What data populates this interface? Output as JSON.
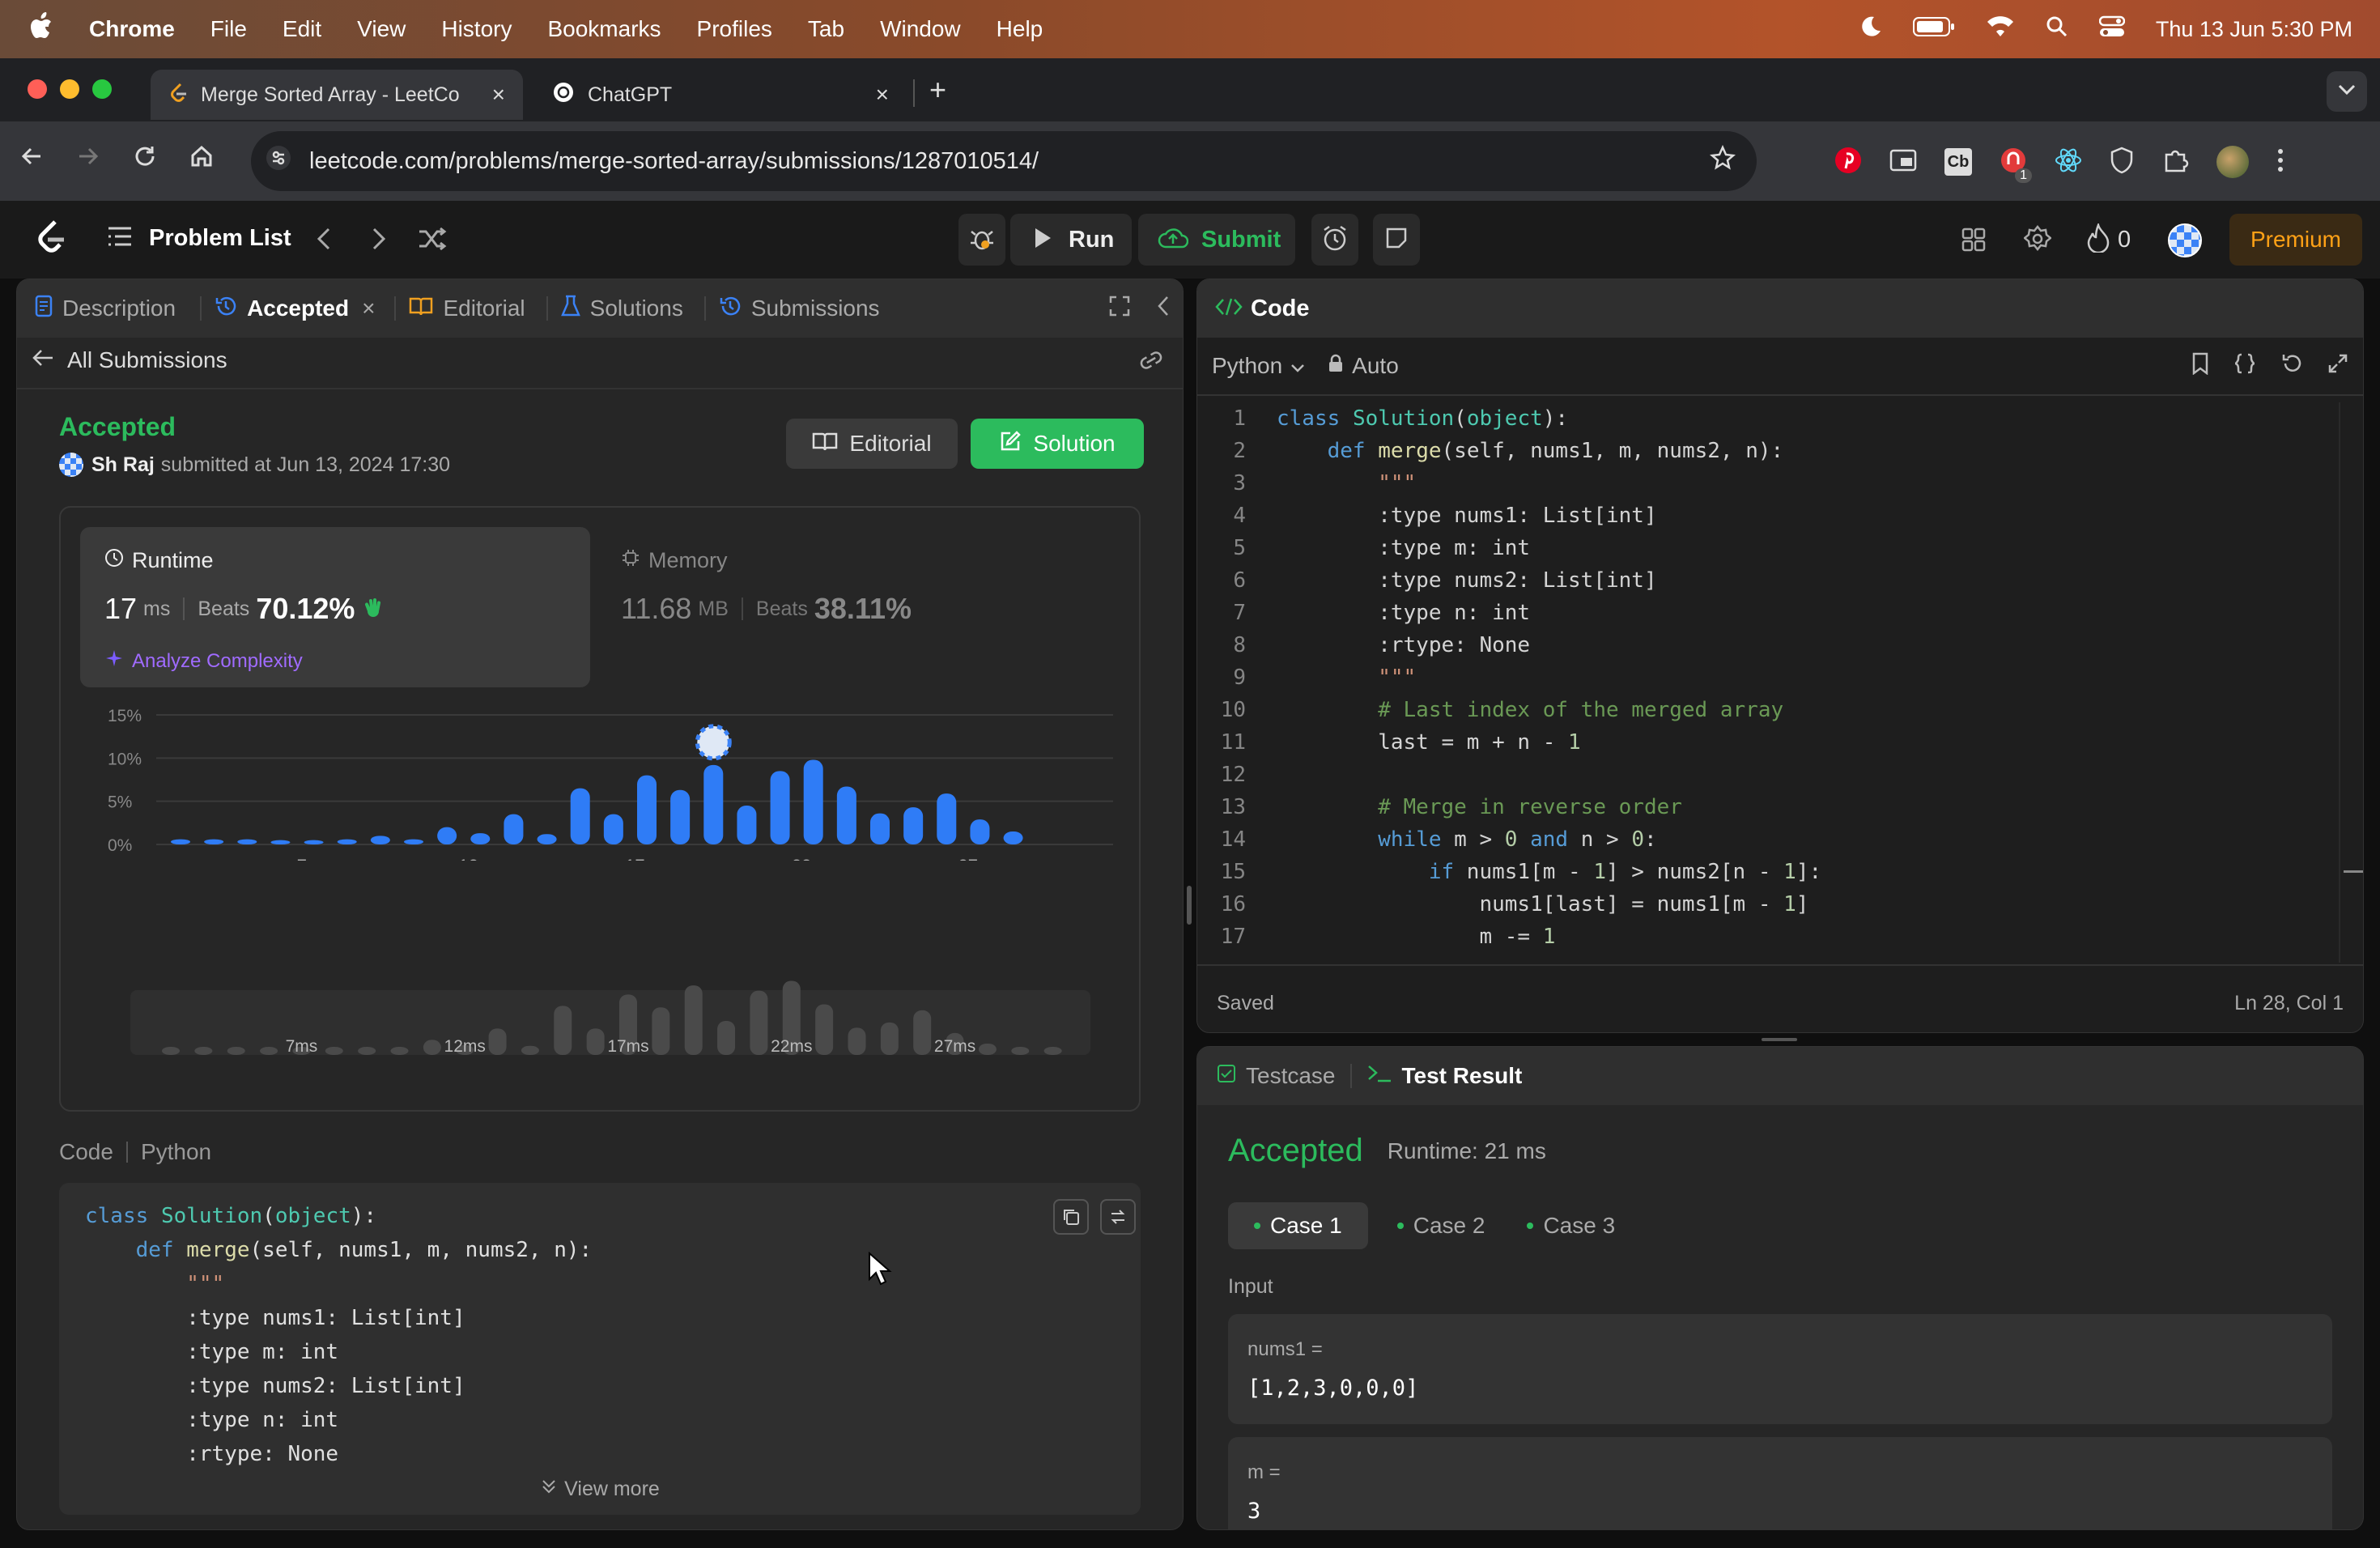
{
  "menubar": {
    "app": "Chrome",
    "items": [
      "File",
      "Edit",
      "View",
      "History",
      "Bookmarks",
      "Profiles",
      "Tab",
      "Window",
      "Help"
    ],
    "datetime": "Thu 13 Jun  5:30 PM"
  },
  "tabs": [
    {
      "title": "Merge Sorted Array - LeetCo"
    },
    {
      "title": "ChatGPT"
    }
  ],
  "url": "leetcode.com/problems/merge-sorted-array/submissions/1287010514/",
  "extension_badge": "1",
  "lc_toolbar": {
    "problem_list": "Problem List",
    "run": "Run",
    "submit": "Submit",
    "streak": "0",
    "premium": "Premium"
  },
  "left_tabs": [
    "Description",
    "Accepted",
    "Editorial",
    "Solutions",
    "Submissions"
  ],
  "all_submissions": "All Submissions",
  "submission": {
    "status": "Accepted",
    "user": "Sh Raj",
    "submitted_text": "submitted at Jun 13, 2024 17:30",
    "editorial_btn": "Editorial",
    "solution_btn": "Solution"
  },
  "runtime": {
    "label": "Runtime",
    "value": "17",
    "unit": "ms",
    "beats_label": "Beats",
    "beats": "70.12%",
    "analyze": "Analyze Complexity"
  },
  "memory": {
    "label": "Memory",
    "value": "11.68",
    "unit": "MB",
    "beats_label": "Beats",
    "beats": "38.11%"
  },
  "chart_data": {
    "type": "bar",
    "x": [
      1,
      2,
      3,
      4,
      5,
      6,
      7,
      8,
      9,
      10,
      11,
      12,
      13,
      14,
      15,
      16,
      17,
      18,
      19,
      20,
      21,
      22,
      23,
      24,
      25,
      26,
      27,
      28
    ],
    "values": [
      0.6,
      0.6,
      0.6,
      0.5,
      0.5,
      0.6,
      1.0,
      0.6,
      2.0,
      1.3,
      3.5,
      1.2,
      6.5,
      3.5,
      8.0,
      6.3,
      9.2,
      4.5,
      8.5,
      9.8,
      6.7,
      3.6,
      4.3,
      5.9,
      2.9,
      1.5,
      0,
      0
    ],
    "highlight_x": 17,
    "ylim": [
      0,
      15
    ],
    "yticks": [
      "15%",
      "10%",
      "5%",
      "0%"
    ],
    "xticks": [
      "7ms",
      "12ms",
      "17ms",
      "22ms",
      "27ms"
    ],
    "bar_color": "#2f7cf6"
  },
  "code_section": {
    "label": "Code",
    "lang": "Python",
    "lines": [
      "class Solution(object):",
      "    def merge(self, nums1, m, nums2, n):",
      "        \"\"\"",
      "        :type nums1: List[int]",
      "        :type m: int",
      "        :type nums2: List[int]",
      "        :type n: int",
      "        :rtype: None"
    ],
    "view_more": "View more"
  },
  "editor": {
    "title": "Code",
    "lang": "Python",
    "mode": "Auto",
    "saved": "Saved",
    "cursor": "Ln 28, Col 1",
    "lines": [
      "class Solution(object):",
      "    def merge(self, nums1, m, nums2, n):",
      "        \"\"\"",
      "        :type nums1: List[int]",
      "        :type m: int",
      "        :type nums2: List[int]",
      "        :type n: int",
      "        :rtype: None",
      "        \"\"\"",
      "        # Last index of the merged array",
      "        last = m + n - 1",
      "",
      "        # Merge in reverse order",
      "        while m > 0 and n > 0:",
      "            if nums1[m - 1] > nums2[n - 1]:",
      "                nums1[last] = nums1[m - 1]",
      "                m -= 1"
    ]
  },
  "testpanel": {
    "tab1": "Testcase",
    "tab2": "Test Result",
    "status": "Accepted",
    "runtime": "Runtime: 21 ms",
    "cases": [
      "Case 1",
      "Case 2",
      "Case 3"
    ],
    "input_label": "Input",
    "inputs": [
      {
        "name": "nums1 =",
        "value": "[1,2,3,0,0,0]"
      },
      {
        "name": "m =",
        "value": "3"
      }
    ]
  }
}
